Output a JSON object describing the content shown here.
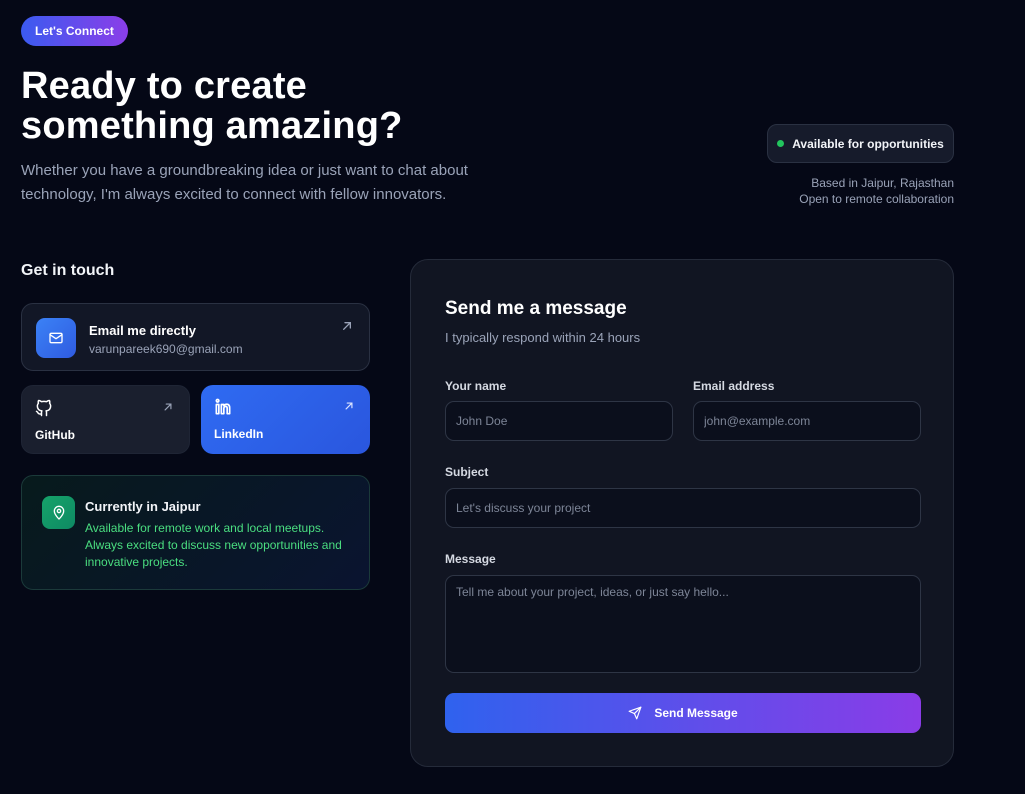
{
  "badge": {
    "label": "Let's Connect"
  },
  "hero": {
    "title_line1": "Ready to create",
    "title_line2": "something amazing?",
    "subtitle": "Whether you have a groundbreaking idea or just want to chat about technology, I'm always excited to connect with fellow innovators."
  },
  "availability": {
    "label": "Available for opportunities",
    "location": "Based in Jaipur, Rajasthan",
    "remote": "Open to remote collaboration"
  },
  "contact": {
    "heading": "Get in touch",
    "email": {
      "title": "Email me directly",
      "address": "varunpareek690@gmail.com"
    },
    "github": {
      "label": "GitHub"
    },
    "linkedin": {
      "label": "LinkedIn"
    },
    "location_card": {
      "title": "Currently in Jaipur",
      "text": "Available for remote work and local meetups. Always excited to discuss new opportunities and innovative projects."
    }
  },
  "form": {
    "title": "Send me a message",
    "subtitle": "I typically respond within 24 hours",
    "name": {
      "label": "Your name",
      "placeholder": "John Doe",
      "value": ""
    },
    "email": {
      "label": "Email address",
      "placeholder": "john@example.com",
      "value": ""
    },
    "subject": {
      "label": "Subject",
      "placeholder": "Let's discuss your project",
      "value": ""
    },
    "message": {
      "label": "Message",
      "placeholder": "Tell me about your project, ideas, or just say hello...",
      "value": ""
    },
    "submit_label": "Send Message"
  },
  "icons": {
    "email": "mail-icon",
    "arrow": "arrow-up-right-icon",
    "github": "github-icon",
    "linkedin": "linkedin-icon",
    "location": "map-pin-icon",
    "send": "send-icon"
  },
  "colors": {
    "background": "#050816",
    "accent_start": "#2f62ee",
    "accent_end": "#8a3ce7",
    "available": "#22c55e",
    "location_text": "#4ade80"
  }
}
